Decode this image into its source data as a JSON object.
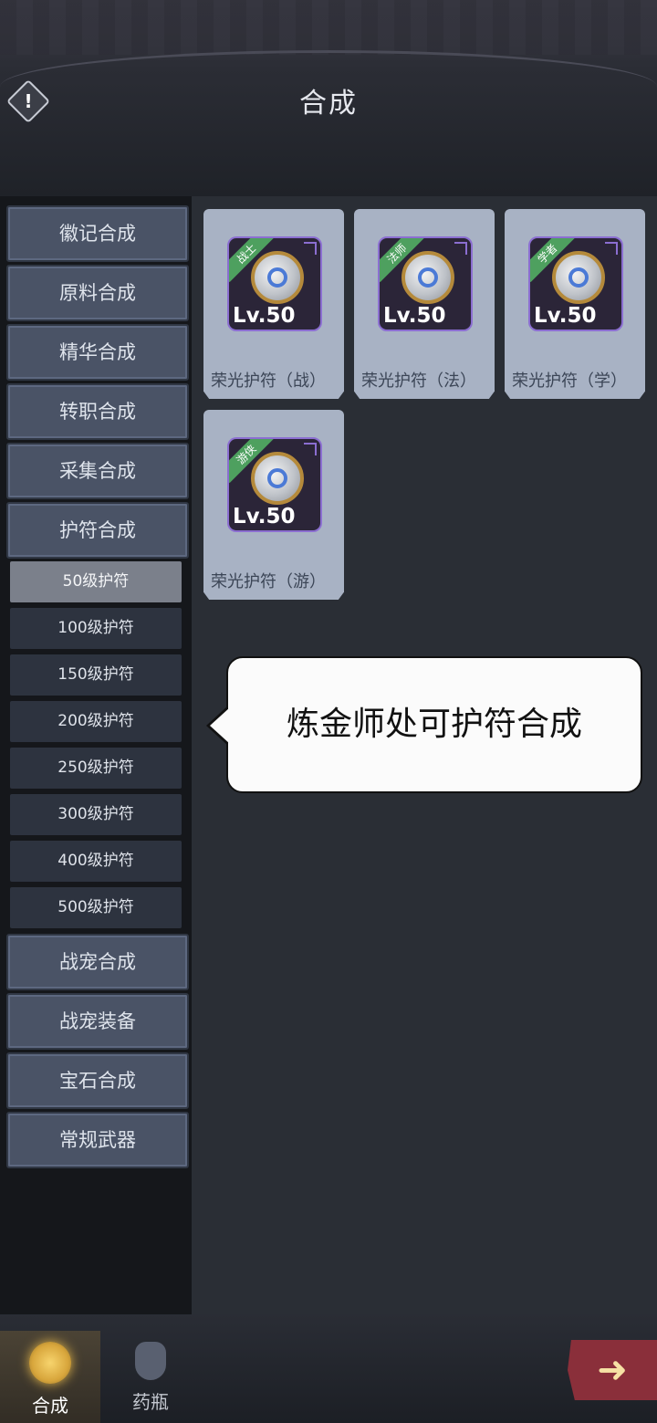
{
  "header": {
    "title": "合成",
    "info_icon": "!"
  },
  "menu": [
    {
      "label": "徽记合成"
    },
    {
      "label": "原料合成"
    },
    {
      "label": "精华合成"
    },
    {
      "label": "转职合成"
    },
    {
      "label": "采集合成"
    },
    {
      "label": "护符合成"
    }
  ],
  "submenu": [
    {
      "label": "50级护符",
      "active": true
    },
    {
      "label": "100级护符"
    },
    {
      "label": "150级护符"
    },
    {
      "label": "200级护符"
    },
    {
      "label": "250级护符"
    },
    {
      "label": "300级护符"
    },
    {
      "label": "400级护符"
    },
    {
      "label": "500级护符"
    }
  ],
  "menu_bottom": [
    {
      "label": "战宠合成"
    },
    {
      "label": "战宠装备"
    },
    {
      "label": "宝石合成"
    },
    {
      "label": "常规武器"
    }
  ],
  "items": [
    {
      "name": "荣光护符（战）",
      "tag": "战士",
      "level": "Lv.50"
    },
    {
      "name": "荣光护符（法）",
      "tag": "法师",
      "level": "Lv.50"
    },
    {
      "name": "荣光护符（学）",
      "tag": "学者",
      "level": "Lv.50"
    },
    {
      "name": "荣光护符（游）",
      "tag": "游侠",
      "level": "Lv.50"
    }
  ],
  "tooltip": {
    "text": "炼金师处可护符合成"
  },
  "bottom_tabs": [
    {
      "label": "合成",
      "icon": "synthesis-icon",
      "active": true
    },
    {
      "label": "药瓶",
      "icon": "potion-icon"
    }
  ],
  "next_button": {
    "icon": "arrow-right-icon",
    "glyph": "➜"
  },
  "colors": {
    "menu_bg": "#4a5366",
    "sub_bg": "#2d333f",
    "sub_active": "#7b808b",
    "card_bg": "#a8b2c4",
    "tag_green": "#4ea05f"
  }
}
